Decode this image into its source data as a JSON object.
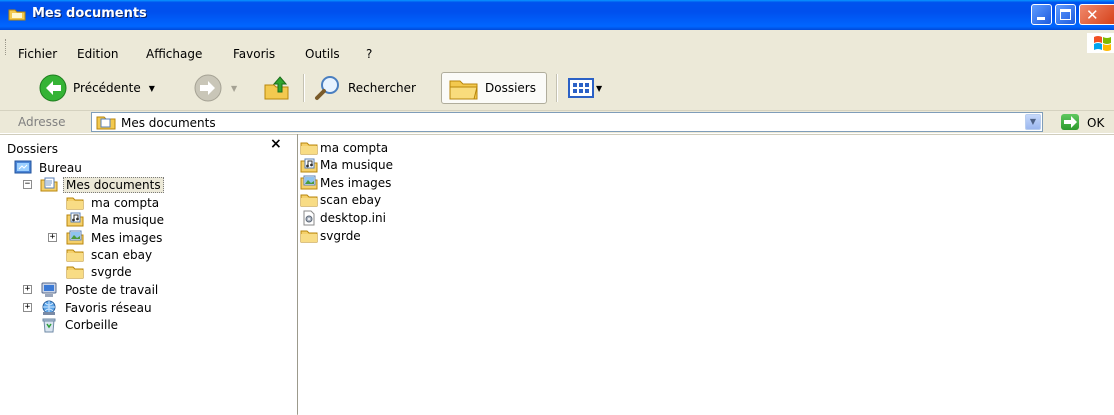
{
  "window": {
    "title": "Mes documents"
  },
  "menu": {
    "items": [
      {
        "label": "Fichier"
      },
      {
        "label": "Edition"
      },
      {
        "label": "Affichage"
      },
      {
        "label": "Favoris"
      },
      {
        "label": "Outils"
      },
      {
        "label": "?"
      }
    ]
  },
  "toolbar": {
    "back_label": "Précédente",
    "search_label": "Rechercher",
    "folders_label": "Dossiers"
  },
  "address": {
    "label": "Adresse",
    "value": "Mes documents",
    "go_label": "OK"
  },
  "folders_pane": {
    "title": "Dossiers",
    "close_glyph": "×",
    "tree": [
      {
        "label": "Bureau",
        "icon": "desktop-icon",
        "level": 0,
        "expander": "none"
      },
      {
        "label": "Mes documents",
        "icon": "documents-folder-icon",
        "level": 1,
        "expander": "minus",
        "selected": true
      },
      {
        "label": "ma compta",
        "icon": "folder-icon",
        "level": 2,
        "expander": "none"
      },
      {
        "label": "Ma musique",
        "icon": "music-folder-icon",
        "level": 2,
        "expander": "none"
      },
      {
        "label": "Mes images",
        "icon": "pictures-folder-icon",
        "level": 2,
        "expander": "plus"
      },
      {
        "label": "scan ebay",
        "icon": "folder-icon",
        "level": 2,
        "expander": "none"
      },
      {
        "label": "svgrde",
        "icon": "folder-icon",
        "level": 2,
        "expander": "none"
      },
      {
        "label": "Poste de travail",
        "icon": "my-computer-icon",
        "level": 1,
        "expander": "plus"
      },
      {
        "label": "Favoris réseau",
        "icon": "network-icon",
        "level": 1,
        "expander": "plus"
      },
      {
        "label": "Corbeille",
        "icon": "recycle-bin-icon",
        "level": 1,
        "expander": "none"
      }
    ]
  },
  "files": [
    {
      "name": "ma compta",
      "icon": "folder-icon"
    },
    {
      "name": "Ma musique",
      "icon": "music-folder-icon"
    },
    {
      "name": "Mes images",
      "icon": "pictures-folder-icon"
    },
    {
      "name": "scan ebay",
      "icon": "folder-icon"
    },
    {
      "name": "desktop.ini",
      "icon": "settings-file-icon"
    },
    {
      "name": "svgrde",
      "icon": "folder-icon"
    }
  ],
  "colors": {
    "titlebar": "#0053ee",
    "chrome": "#ece9d8",
    "folder": "#f5d06b"
  }
}
